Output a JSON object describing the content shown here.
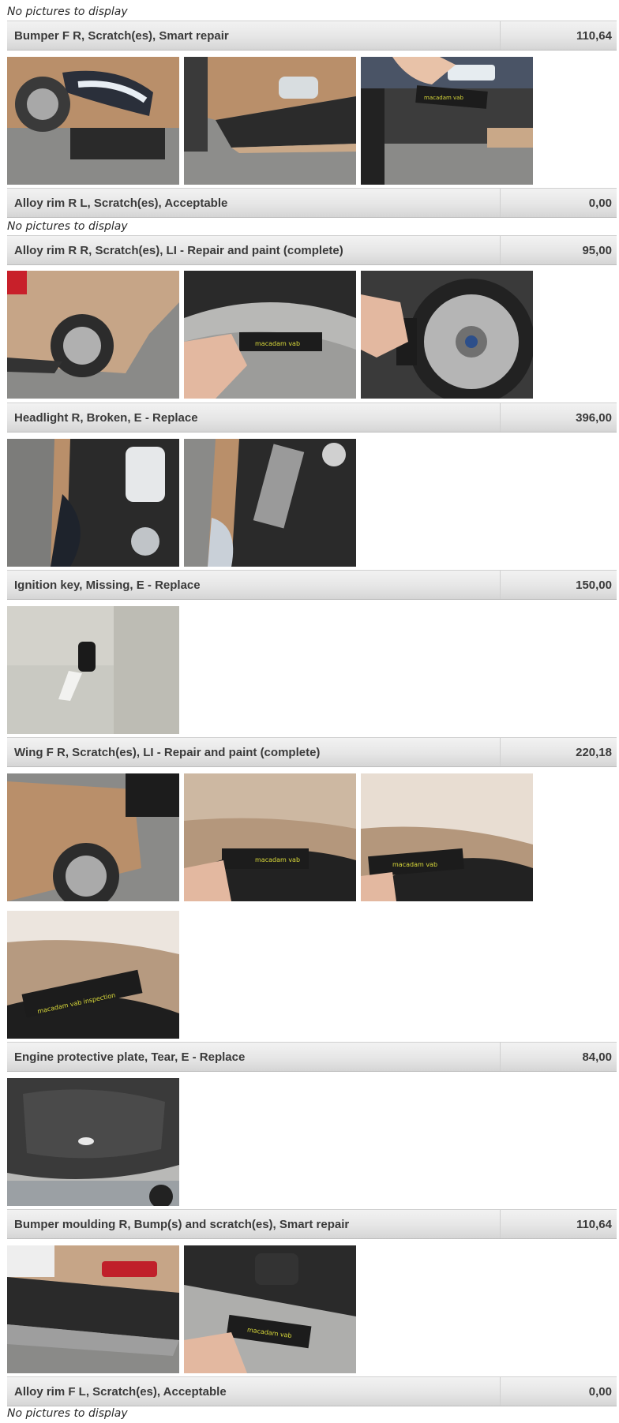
{
  "no_pictures_text": "No pictures to display",
  "damage_items": [
    {
      "description": "Bumper F R, Scratch(es), Smart repair",
      "price": "110,64",
      "photos": [
        "bumper-front-right",
        "bumper-corner-closeup",
        "bumper-gauge-closeup"
      ]
    },
    {
      "description": "Alloy rim R L, Scratch(es), Acceptable",
      "price": "0,00",
      "photos": []
    },
    {
      "description": "Alloy rim R R, Scratch(es), LI - Repair and paint (complete)",
      "price": "95,00",
      "photos": [
        "rear-wheel-overview",
        "rim-gauge-closeup",
        "rim-hand-closeup"
      ]
    },
    {
      "description": "Headlight R, Broken, E - Replace",
      "price": "396,00",
      "photos": [
        "engine-bay-headlight",
        "headlight-bracket"
      ]
    },
    {
      "description": "Ignition key, Missing, E - Replace",
      "price": "150,00",
      "photos": [
        "key-on-seat"
      ]
    },
    {
      "description": "Wing F R, Scratch(es), LI - Repair and paint (complete)",
      "price": "220,18",
      "photos": [
        "front-wing-overview",
        "wing-gauge-1",
        "wing-gauge-2",
        "wing-gauge-3"
      ]
    },
    {
      "description": "Engine protective plate, Tear, E - Replace",
      "price": "84,00",
      "photos": [
        "hood-underside"
      ]
    },
    {
      "description": "Bumper moulding R, Bump(s) and scratch(es), Smart repair",
      "price": "110,64",
      "photos": [
        "rear-bumper-overview",
        "rear-bumper-gauge"
      ]
    },
    {
      "description": "Alloy rim F L, Scratch(es), Acceptable",
      "price": "0,00",
      "photos": []
    }
  ],
  "colors": {
    "car_paint": "#b98f6a",
    "asphalt": "#8a8a88",
    "gauge": "#1c1c1c",
    "gauge_text": "#d9d93a"
  }
}
